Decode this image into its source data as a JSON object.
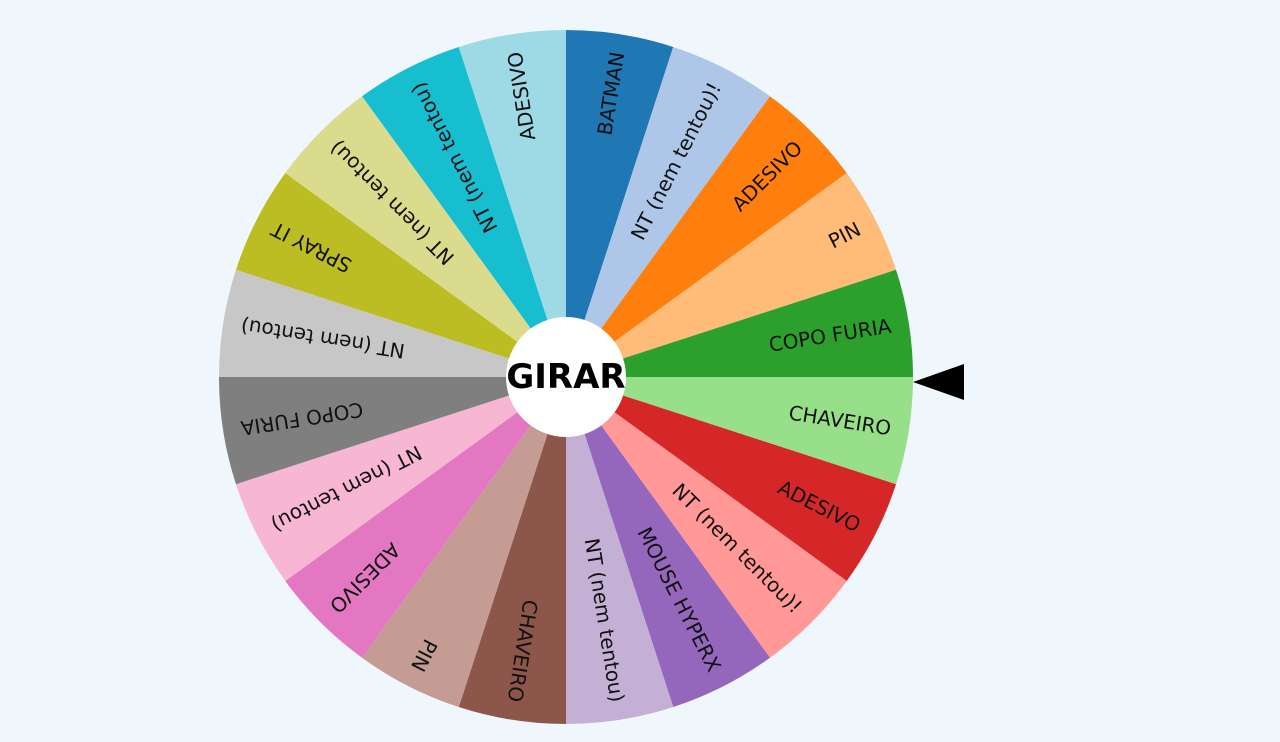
{
  "wheel": {
    "segments": [
      {
        "label": "CHAVEIRO",
        "color": "#98df8a"
      },
      {
        "label": "ADESIVO",
        "color": "#d62728"
      },
      {
        "label": "NT (nem tentou)!",
        "color": "#ff9896"
      },
      {
        "label": "MOUSE HYPERX",
        "color": "#9467bd"
      },
      {
        "label": "NT (nem tentou)",
        "color": "#c5b0d5"
      },
      {
        "label": "CHAVEIRO",
        "color": "#8c564b"
      },
      {
        "label": "PIN",
        "color": "#c49c94"
      },
      {
        "label": "ADESIVO",
        "color": "#e377c2"
      },
      {
        "label": "NT (nem tentou)",
        "color": "#f7b6d2"
      },
      {
        "label": "COPO FURIA",
        "color": "#7f7f7f"
      },
      {
        "label": "NT (nem tentou)",
        "color": "#c7c7c7"
      },
      {
        "label": "SPRAY IT",
        "color": "#bcbd22"
      },
      {
        "label": "NT (nem tentou)",
        "color": "#dbdb8d"
      },
      {
        "label": "NT (nem tentou)",
        "color": "#17becf"
      },
      {
        "label": "ADESIVO",
        "color": "#9edae5"
      },
      {
        "label": "BATMAN",
        "color": "#1f77b4"
      },
      {
        "label": "NT (nem tentou)!",
        "color": "#aec7e8"
      },
      {
        "label": "ADESIVO",
        "color": "#ff7f0e"
      },
      {
        "label": "PIN",
        "color": "#ffbb78"
      },
      {
        "label": "COPO FURIA",
        "color": "#2ca02c"
      }
    ]
  },
  "spin_button": {
    "label": "GIRAR"
  },
  "pointer": {
    "icon": "triangle-pointer-icon",
    "color": "#000000"
  }
}
